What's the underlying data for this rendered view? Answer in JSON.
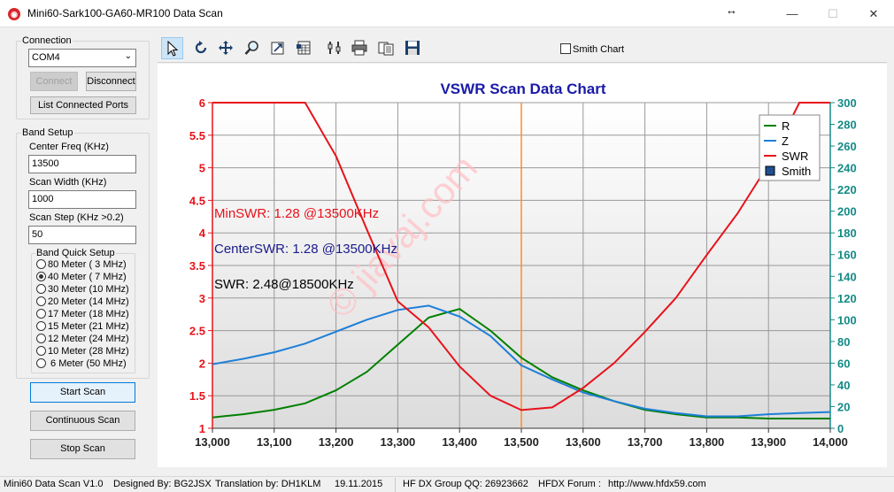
{
  "window": {
    "title": "Mini60-Sark100-GA60-MR100 Data Scan",
    "icon_name": "app-logo-icon"
  },
  "connection": {
    "group_label": "Connection",
    "port_value": "COM4",
    "connect_label": "Connect",
    "disconnect_label": "Disconnect",
    "list_ports_label": "List Connected Ports"
  },
  "band_setup": {
    "group_label": "Band Setup",
    "center_freq_label": "Center Freq  (KHz)",
    "center_freq_value": "13500",
    "scan_width_label": "Scan Width   (KHz)",
    "scan_width_value": "1000",
    "scan_step_label": "Scan Step     (KHz >0.2)",
    "scan_step_value": "50",
    "quick_setup_label": "Band Quick Setup",
    "bands": [
      {
        "label": "80 Meter  (  3 MHz)",
        "selected": false
      },
      {
        "label": "40 Meter  (  7 MHz)",
        "selected": true
      },
      {
        "label": "30 Meter (10 MHz)",
        "selected": false
      },
      {
        "label": "20 Meter (14 MHz)",
        "selected": false
      },
      {
        "label": "17 Meter (18 MHz)",
        "selected": false
      },
      {
        "label": "15 Meter (21 MHz)",
        "selected": false
      },
      {
        "label": "12 Meter (24 MHz)",
        "selected": false
      },
      {
        "label": "10 Meter (28 MHz)",
        "selected": false
      },
      {
        "label": "  6 Meter  (50 MHz)",
        "selected": false
      }
    ]
  },
  "actions": {
    "start_scan": "Start Scan",
    "continuous_scan": "Continuous Scan",
    "stop_scan": "Stop Scan"
  },
  "toolbar": {
    "tools": [
      "pointer-icon",
      "rotate-icon",
      "pan-icon",
      "zoom-icon",
      "export-icon",
      "data-grid-icon",
      "settings-icon",
      "print-icon",
      "copy-icon",
      "save-icon"
    ],
    "smith_chart_label": "Smith Chart",
    "smith_chart_checked": false
  },
  "chart_data": {
    "type": "line",
    "title": "VSWR Scan Data Chart",
    "x": [
      13000,
      13050,
      13100,
      13150,
      13200,
      13250,
      13300,
      13350,
      13400,
      13450,
      13500,
      13550,
      13600,
      13650,
      13700,
      13750,
      13800,
      13850,
      13900,
      13950,
      14000
    ],
    "x_tick_labels": [
      "13,000",
      "13,100",
      "13,200",
      "13,300",
      "13,400",
      "13,500",
      "13,600",
      "13,700",
      "13,800",
      "13,900",
      "14,000"
    ],
    "x_ticks": [
      13000,
      13100,
      13200,
      13300,
      13400,
      13500,
      13600,
      13700,
      13800,
      13900,
      14000
    ],
    "xlim": [
      13000,
      14000
    ],
    "ylim_left": [
      1,
      6
    ],
    "y_left_ticks": [
      "1",
      "1.5",
      "2",
      "2.5",
      "3",
      "3.5",
      "4",
      "4.5",
      "5",
      "5.5",
      "6"
    ],
    "ylim_right": [
      0,
      300
    ],
    "y_right_ticks": [
      "0",
      "20",
      "40",
      "60",
      "80",
      "100",
      "120",
      "140",
      "160",
      "180",
      "200",
      "220",
      "240",
      "260",
      "280",
      "300"
    ],
    "grid": true,
    "legend_position": "top-right",
    "series": [
      {
        "name": "R",
        "color": "#008000",
        "axis": "right",
        "values": [
          10,
          13,
          17,
          23,
          35,
          52,
          77,
          102,
          110,
          90,
          65,
          47,
          35,
          25,
          17,
          13,
          10,
          10,
          9,
          9,
          9
        ]
      },
      {
        "name": "Z",
        "color": "#1e7fd8",
        "axis": "right",
        "values": [
          59,
          64,
          70,
          78,
          89,
          100,
          109,
          113,
          103,
          85,
          58,
          45,
          33,
          25,
          18,
          14,
          11,
          11,
          13,
          14,
          15
        ]
      },
      {
        "name": "SWR",
        "color": "#e8121a",
        "axis": "left",
        "values": [
          6,
          6,
          6,
          6,
          5.18,
          4.05,
          2.95,
          2.55,
          1.95,
          1.5,
          1.28,
          1.32,
          1.62,
          2.0,
          2.48,
          3.0,
          3.66,
          4.3,
          5.05,
          6,
          6
        ]
      },
      {
        "name": "Smith",
        "color": "#1f4f8f",
        "axis": "none",
        "values": []
      }
    ],
    "marker_x": 13500,
    "marker_color": "#ff8c28",
    "annotations": [
      {
        "text": "MinSWR: 1.28 @13500KHz",
        "color": "#e8121a"
      },
      {
        "text": "CenterSWR: 1.28 @13500KHz",
        "color": "#1a1a8c"
      },
      {
        "text": "SWR: 2.48@18500KHz",
        "color": "#000000"
      }
    ],
    "watermark": "© jiavaj.com"
  },
  "status": {
    "version": "Mini60 Data Scan V1.0",
    "designer": "Designed By: BG2JSX",
    "translation": "Translation by: DH1KLM",
    "date": "19.11.2015",
    "group": "HF DX Group QQ: 26923662",
    "forum": "HFDX Forum :",
    "url": "http://www.hfdx59.com"
  }
}
